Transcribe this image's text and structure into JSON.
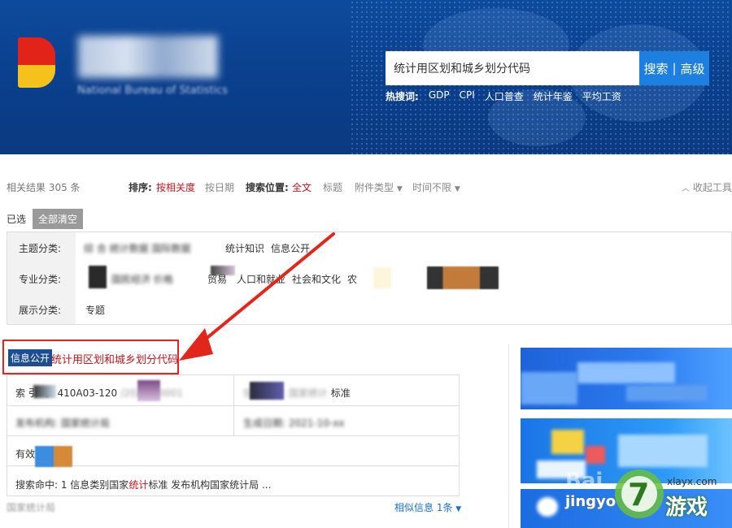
{
  "header": {
    "site_name_en": "National Bureau of Statistics",
    "search": {
      "value": "统计用区划和城乡划分代码",
      "btn_search": "搜索",
      "btn_sep": "|",
      "btn_advanced": "高级"
    },
    "hot": {
      "label": "热搜词:",
      "words": [
        "GDP",
        "CPI",
        "人口普查",
        "统计年鉴",
        "平均工资"
      ]
    }
  },
  "toolbar": {
    "result_count": "相关结果 305 条",
    "sort_label": "排序:",
    "sort_relevance": "按相关度",
    "sort_date": "按日期",
    "pos_label": "搜索位置:",
    "pos_fulltext": "全文",
    "pos_title": "标题",
    "attach_type": "附件类型",
    "time_limit": "时间不限",
    "collapse": "收起工具"
  },
  "selected": {
    "label": "已选",
    "clear": "全部清空"
  },
  "categories": {
    "topic_label": "主题分类:",
    "topic_items": [
      "统计知识",
      "信息公开"
    ],
    "major_label": "专业分类:",
    "major_items": [
      "贸易",
      "人口和就业",
      "社会和文化",
      "农"
    ],
    "display_label": "展示分类:",
    "display_items": [
      "专题"
    ]
  },
  "result": {
    "badge": "信息公开",
    "title": "统计用区划和城乡划分代码",
    "index_label": "索 引 号:",
    "index_value": "410A03-120",
    "info_type_suffix": "标准",
    "valid_label": "有效",
    "hit_prefix": "搜索命中: 1 信息类别国家",
    "hit_word": "统计",
    "hit_suffix": "标准 发布机构国家统计局 ...",
    "similar": "相似信息 1条"
  },
  "watermark": {
    "site": "xlayx.com",
    "brand": "游戏",
    "pinyin": "jingyo"
  },
  "colors": {
    "header_blue": "#0e4a9c",
    "accent_red": "#c0161d",
    "button_blue": "#1d7fe0",
    "badge_navy": "#1d4e92"
  }
}
